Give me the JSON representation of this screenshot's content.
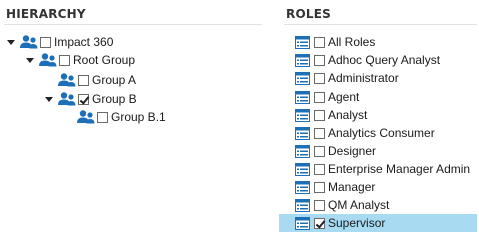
{
  "hierarchy": {
    "title": "HIERARCHY",
    "nodes": [
      {
        "label": "Impact 360",
        "checked": false,
        "expanded": true
      },
      {
        "label": "Root Group",
        "checked": false,
        "expanded": true
      },
      {
        "label": "Group A",
        "checked": false,
        "expanded": false
      },
      {
        "label": "Group B",
        "checked": true,
        "expanded": true
      },
      {
        "label": "Group B.1",
        "checked": false,
        "expanded": false
      }
    ]
  },
  "roles": {
    "title": "ROLES",
    "items": [
      {
        "label": "All Roles",
        "checked": false,
        "selected": false
      },
      {
        "label": "Adhoc Query Analyst",
        "checked": false,
        "selected": false
      },
      {
        "label": "Administrator",
        "checked": false,
        "selected": false
      },
      {
        "label": "Agent",
        "checked": false,
        "selected": false
      },
      {
        "label": "Analyst",
        "checked": false,
        "selected": false
      },
      {
        "label": "Analytics Consumer",
        "checked": false,
        "selected": false
      },
      {
        "label": "Designer",
        "checked": false,
        "selected": false
      },
      {
        "label": "Enterprise Manager Admin",
        "checked": false,
        "selected": false
      },
      {
        "label": "Manager",
        "checked": false,
        "selected": false
      },
      {
        "label": "QM Analyst",
        "checked": false,
        "selected": false
      },
      {
        "label": "Supervisor",
        "checked": true,
        "selected": true
      }
    ]
  },
  "colors": {
    "icon_blue": "#1d6fb8",
    "selected_row": "#a8daf2"
  }
}
